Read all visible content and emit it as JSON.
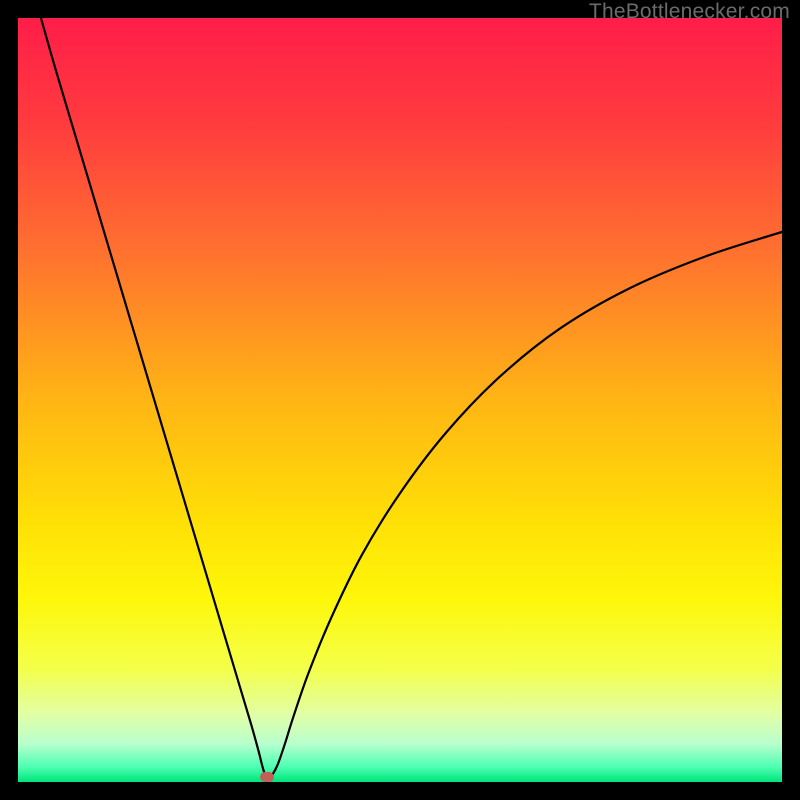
{
  "watermark": {
    "text": "TheBottlenecker.com"
  },
  "colors": {
    "frame": "#000000",
    "curve": "#000000",
    "gradient_stops": [
      {
        "pct": 0,
        "color": "#ff1d49"
      },
      {
        "pct": 14,
        "color": "#ff3c3e"
      },
      {
        "pct": 30,
        "color": "#ff6f30"
      },
      {
        "pct": 50,
        "color": "#ffb514"
      },
      {
        "pct": 66,
        "color": "#ffe006"
      },
      {
        "pct": 76,
        "color": "#fef70a"
      },
      {
        "pct": 85,
        "color": "#f4ff48"
      },
      {
        "pct": 91,
        "color": "#e2ffa4"
      },
      {
        "pct": 95,
        "color": "#b8ffce"
      },
      {
        "pct": 98,
        "color": "#4fffb3"
      },
      {
        "pct": 100,
        "color": "#00e47a"
      }
    ],
    "marker": "#c06058"
  },
  "chart_data": {
    "type": "line",
    "title": "",
    "xlabel": "",
    "ylabel": "",
    "xlim": [
      0,
      100
    ],
    "ylim": [
      0,
      100
    ],
    "grid": false,
    "series": [
      {
        "name": "bottleneck-curve",
        "x": [
          3,
          5,
          7,
          9,
          11,
          13,
          15,
          17,
          19,
          21,
          23,
          25,
          27,
          29,
          30.5,
          31.5,
          32,
          32.4,
          32.8,
          33.2,
          34,
          35,
          36,
          38,
          41,
          45,
          50,
          56,
          63,
          71,
          80,
          90,
          100
        ],
        "y": [
          100,
          93,
          86.3,
          79.6,
          72.9,
          66.2,
          59.5,
          52.8,
          46.1,
          39.4,
          32.7,
          26,
          19.3,
          12.6,
          7.6,
          4,
          2,
          0.8,
          0.4,
          0.8,
          2.3,
          5.2,
          8.4,
          14.2,
          21.5,
          29.7,
          37.8,
          45.7,
          53,
          59.4,
          64.6,
          68.8,
          72
        ]
      }
    ],
    "marker": {
      "x": 32.6,
      "y": 0.6
    },
    "legend": false
  }
}
